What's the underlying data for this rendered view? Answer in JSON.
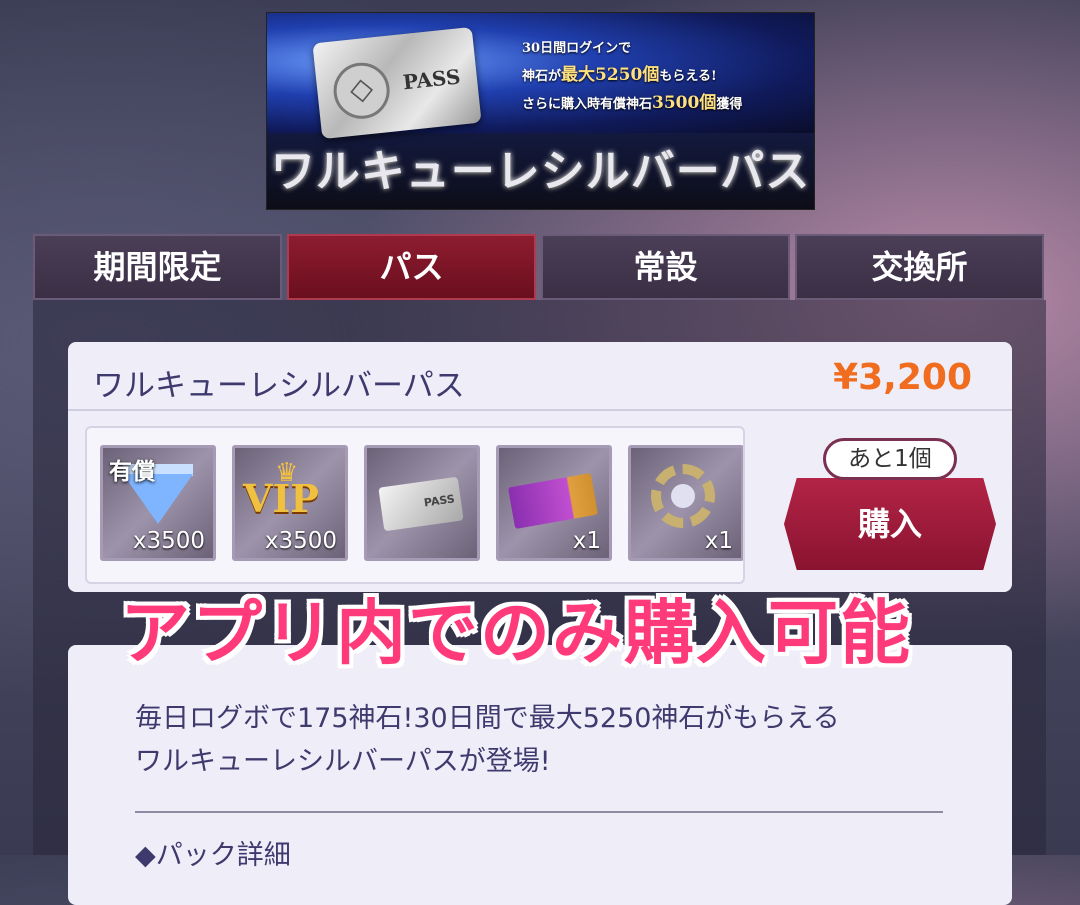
{
  "banner": {
    "ticket_label": "PASS",
    "line1": "30日間ログインで",
    "line2_pre": "神石が",
    "line2_hl": "最大5250個",
    "line2_post": "もらえる!",
    "line3_pre": "さらに購入時有償神石",
    "line3_hl": "3500個",
    "line3_post": "獲得",
    "title": "ワルキューレシルバーパス"
  },
  "tabs": [
    {
      "label": "期間限定"
    },
    {
      "label": "パス"
    },
    {
      "label": "常設"
    },
    {
      "label": "交換所"
    }
  ],
  "product": {
    "title": "ワルキューレシルバーパス",
    "price": "¥3,200",
    "items": [
      {
        "tag": "有償",
        "qty": "x3500",
        "icon": "diamond-icon"
      },
      {
        "tag": "",
        "qty": "x3500",
        "icon": "vip-icon",
        "art_text": "VIP"
      },
      {
        "tag": "",
        "qty": "",
        "icon": "silver-pass-icon",
        "art_text": "PASS"
      },
      {
        "tag": "",
        "qty": "x1",
        "icon": "ticket-icon"
      },
      {
        "tag": "",
        "qty": "x1",
        "icon": "gear-icon"
      }
    ],
    "remaining": "あと1個",
    "buy_label": "購入"
  },
  "overlay": "アプリ内でのみ購入可能",
  "description": {
    "line1": "毎日ログボで175神石!30日間で最大5250神石がもらえる",
    "line2": "ワルキューレシルバーパスが登場!",
    "details_heading": "◆パック詳細"
  },
  "colors": {
    "price": "#f06c1e",
    "active_tab": "#8e1c30",
    "overlay_text": "#ff3a7a",
    "buy_button": "#b32446"
  }
}
